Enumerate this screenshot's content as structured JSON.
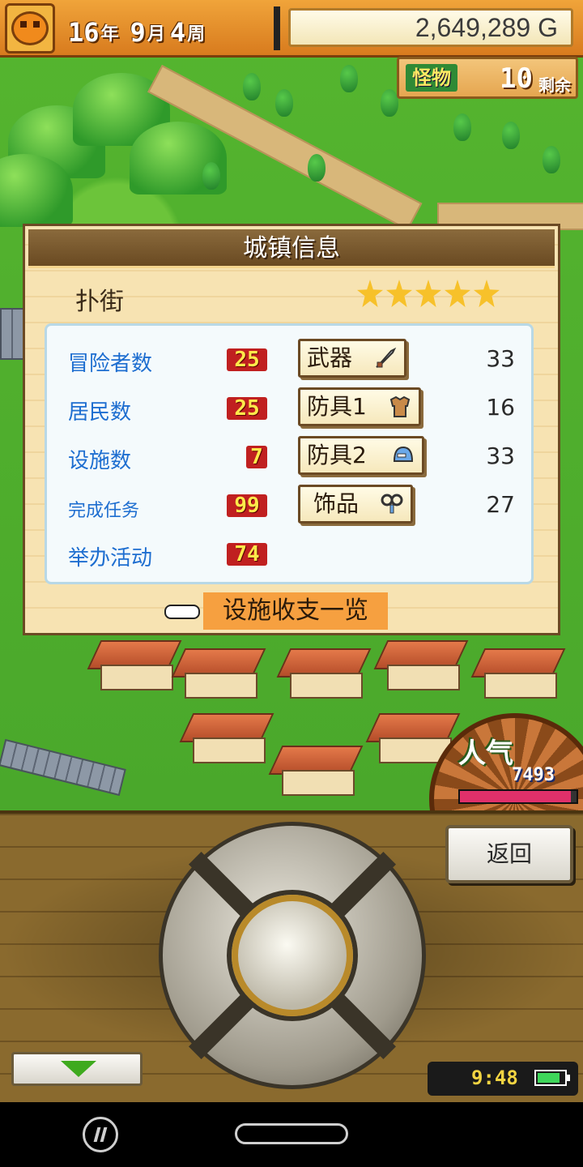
{
  "hud": {
    "year": "16",
    "year_unit": "年",
    "month": "9",
    "month_unit": "月",
    "week": "4",
    "week_unit": "周",
    "money": "2,649,289 G",
    "monster_label": "怪物",
    "monster_count": "10",
    "monster_unit": "剩余"
  },
  "dialog": {
    "title": "城镇信息",
    "town_name": "扑街",
    "star_rating": 5,
    "stats": [
      {
        "label": "冒险者数",
        "value": "25"
      },
      {
        "label": "居民数",
        "value": "25"
      },
      {
        "label": "设施数",
        "value": "7"
      },
      {
        "label": "完成任务",
        "value": "99"
      },
      {
        "label": "举办活动",
        "value": "74"
      }
    ],
    "equipment": [
      {
        "label": "武器",
        "icon": "sword-icon",
        "count": "33"
      },
      {
        "label": "防具1",
        "icon": "armor-icon",
        "count": "16"
      },
      {
        "label": "防具2",
        "icon": "helmet-icon",
        "count": "33"
      },
      {
        "label": "饰品",
        "icon": "accessory-icon",
        "count": "27"
      }
    ],
    "facility_link": "设施收支一览"
  },
  "popularity": {
    "label": "人气",
    "value": "7493",
    "bar_fraction": 0.95
  },
  "controls": {
    "back_label": "返回",
    "time": "9:48",
    "battery_fraction": 0.85
  },
  "colors": {
    "stat_label": "#1e6ed0",
    "stat_value_bg": "#c02020",
    "stat_value_text": "#ffe94a",
    "link_bg": "#f6a040",
    "popularity_bar": "#e0306a"
  }
}
